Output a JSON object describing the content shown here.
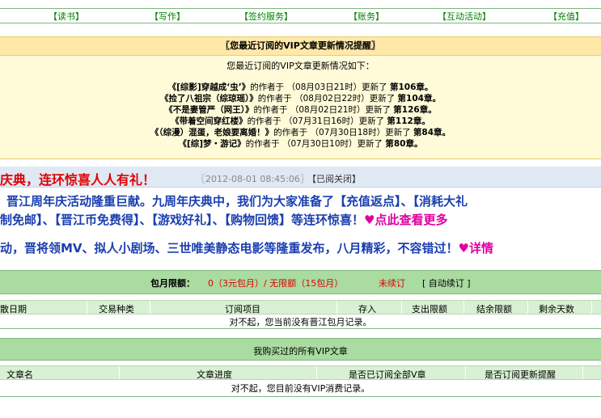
{
  "nav": [
    "【读书】",
    "【写作】",
    "【签约服务】",
    "【账务】",
    "【互动活动】",
    "【充值】"
  ],
  "vip": {
    "title": "〖您最近订阅的VIP文章更新情况提醒〗",
    "intro": "您最近订阅的VIP文章更新情况如下：",
    "rows": [
      {
        "name": "《[综影]穿越成‘虫’》",
        "mid": "的作者于 （08月03日21时）更新了",
        "chapter": "第106章。"
      },
      {
        "name": "《捡了八祖宗（综琼瑶）》",
        "mid": "的作者于 （08月02日22时）更新了",
        "chapter": "第104章。"
      },
      {
        "name": "《不是妻管严（网王）》",
        "mid": "的作者于 （08月02日21时）更新了",
        "chapter": "第126章。"
      },
      {
        "name": "《带着空间穿红楼》",
        "mid": "的作者于 （07月31日16时）更新了",
        "chapter": "第112章。"
      },
      {
        "name": "《（综漫）混蛋，老娘要离婚！》",
        "mid": "的作者于 （07月30日18时）更新了",
        "chapter": "第84章。"
      },
      {
        "name": "《[综]梦・游记》",
        "mid": "的作者于 （07月30日10时）更新了",
        "chapter": "第80章。"
      }
    ]
  },
  "announcement": {
    "title": "庆典，连环惊喜人人有礼！",
    "time": "〖2012-08-01 08:45:06〗",
    "closed": "【已阅关闭】",
    "line1": "晋江周年庆活动隆重巨献。九周年庆典中，我们为大家准备了【充值返点】、【消耗大礼",
    "line2a": "制免邮】、【晋江币免费得】、【游戏好礼】、【购物回馈】等连环惊喜！",
    "line2b": "♥点此查看更多",
    "line3a": "动，晋将领MV、拟人小剧场、三世唯美静态电影等隆重发布，八月精彩，不容错过！",
    "line3b": "♥详情"
  },
  "baoyue": {
    "label": "包月限额：",
    "value": "0（3元包月）/ 无限额（15包月）",
    "status": "未续订",
    "auto": "[ 自动续订 ]",
    "headers": [
      "散日期",
      "交易种类",
      "订阅项目",
      "存入",
      "支出限额",
      "结余限额",
      "剩余天数"
    ],
    "empty": "对不起，您当前没有晋江包月记录。"
  },
  "purchased": {
    "title": "我购买过的所有VIP文章",
    "headers": [
      "文章名",
      "文章进度",
      "是否已订阅全部V章",
      "是否订阅更新提醒"
    ],
    "empty": "对不起，您目前没有VIP消费记录。"
  }
}
